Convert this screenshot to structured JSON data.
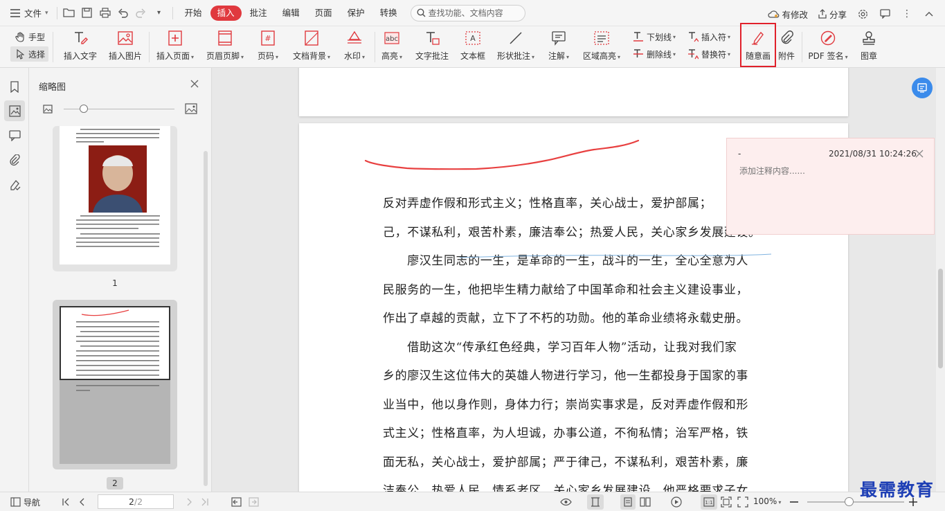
{
  "menubar": {
    "file_label": "文件",
    "tabs": [
      "开始",
      "插入",
      "批注",
      "编辑",
      "页面",
      "保护",
      "转换"
    ],
    "active_tab": "插入",
    "search_placeholder": "查找功能、文档内容",
    "modified_label": "有修改",
    "share_label": "分享"
  },
  "ribbon": {
    "hand_label": "手型",
    "select_label": "选择",
    "insert_text": "插入文字",
    "insert_image": "插入图片",
    "insert_page": "插入页面",
    "header_footer": "页眉页脚",
    "page_number": "页码",
    "doc_background": "文档背景",
    "watermark": "水印",
    "highlight": "高亮",
    "text_annotation": "文字批注",
    "textbox": "文本框",
    "shape_annotation": "形状批注",
    "note": "注解",
    "area_highlight": "区域高亮",
    "underline": "下划线",
    "strikethrough": "删除线",
    "insert_mark": "插入符",
    "replace_mark": "替换符",
    "freehand": "随意画",
    "attachment": "附件",
    "pdf_sign": "PDF 签名",
    "stamp": "图章"
  },
  "sidebar": {
    "title": "缩略图",
    "pages": [
      "1",
      "2"
    ],
    "zoom_fraction": 0.18
  },
  "document": {
    "lines": [
      "反对弄虚作假和形式主义；性格直率，关心战士，爱护部属；",
      "己，不谋私利，艰苦朴素，廉洁奉公；热爱人民，关心家乡发展建设。",
      "　　廖汉生同志的一生，是革命的一生，战斗的一生，全心全意为人",
      "民服务的一生，他把毕生精力献给了中国革命和社会主义建设事业，",
      "作出了卓越的贡献，立下了不朽的功勋。他的革命业绩将永载史册。",
      "　　借助这次“传承红色经典，学习百年人物”活动，让我对我们家",
      "乡的廖汉生这位伟大的英雄人物进行学习，他一生都投身于国家的事",
      "业当中，他以身作则，身体力行；崇尚实事求是，反对弄虚作假和形",
      "式主义；性格直率，为人坦诚，办事公道，不徇私情；治军严格，铁",
      "面无私，关心战士，爱护部属；严于律己，不谋私利，艰苦朴素，廉",
      "洁奉公，热爱人民，情系老区，关心家乡发展建设。他严格要求子女"
    ]
  },
  "comment": {
    "author": "-",
    "time": "2021/08/31 10:24:26",
    "placeholder": "添加注释内容......"
  },
  "statusbar": {
    "nav_label": "导航",
    "current_page": "2",
    "total_pages": "/2",
    "zoom": "100%",
    "zoom_fraction": 0.43
  },
  "branding": {
    "watermark_text": "最需教育"
  },
  "colors": {
    "accent": "#e0393e",
    "freehand_stroke": "#e84040",
    "highlight_box": "#e0202a",
    "fab_blue": "#3b8beb"
  }
}
